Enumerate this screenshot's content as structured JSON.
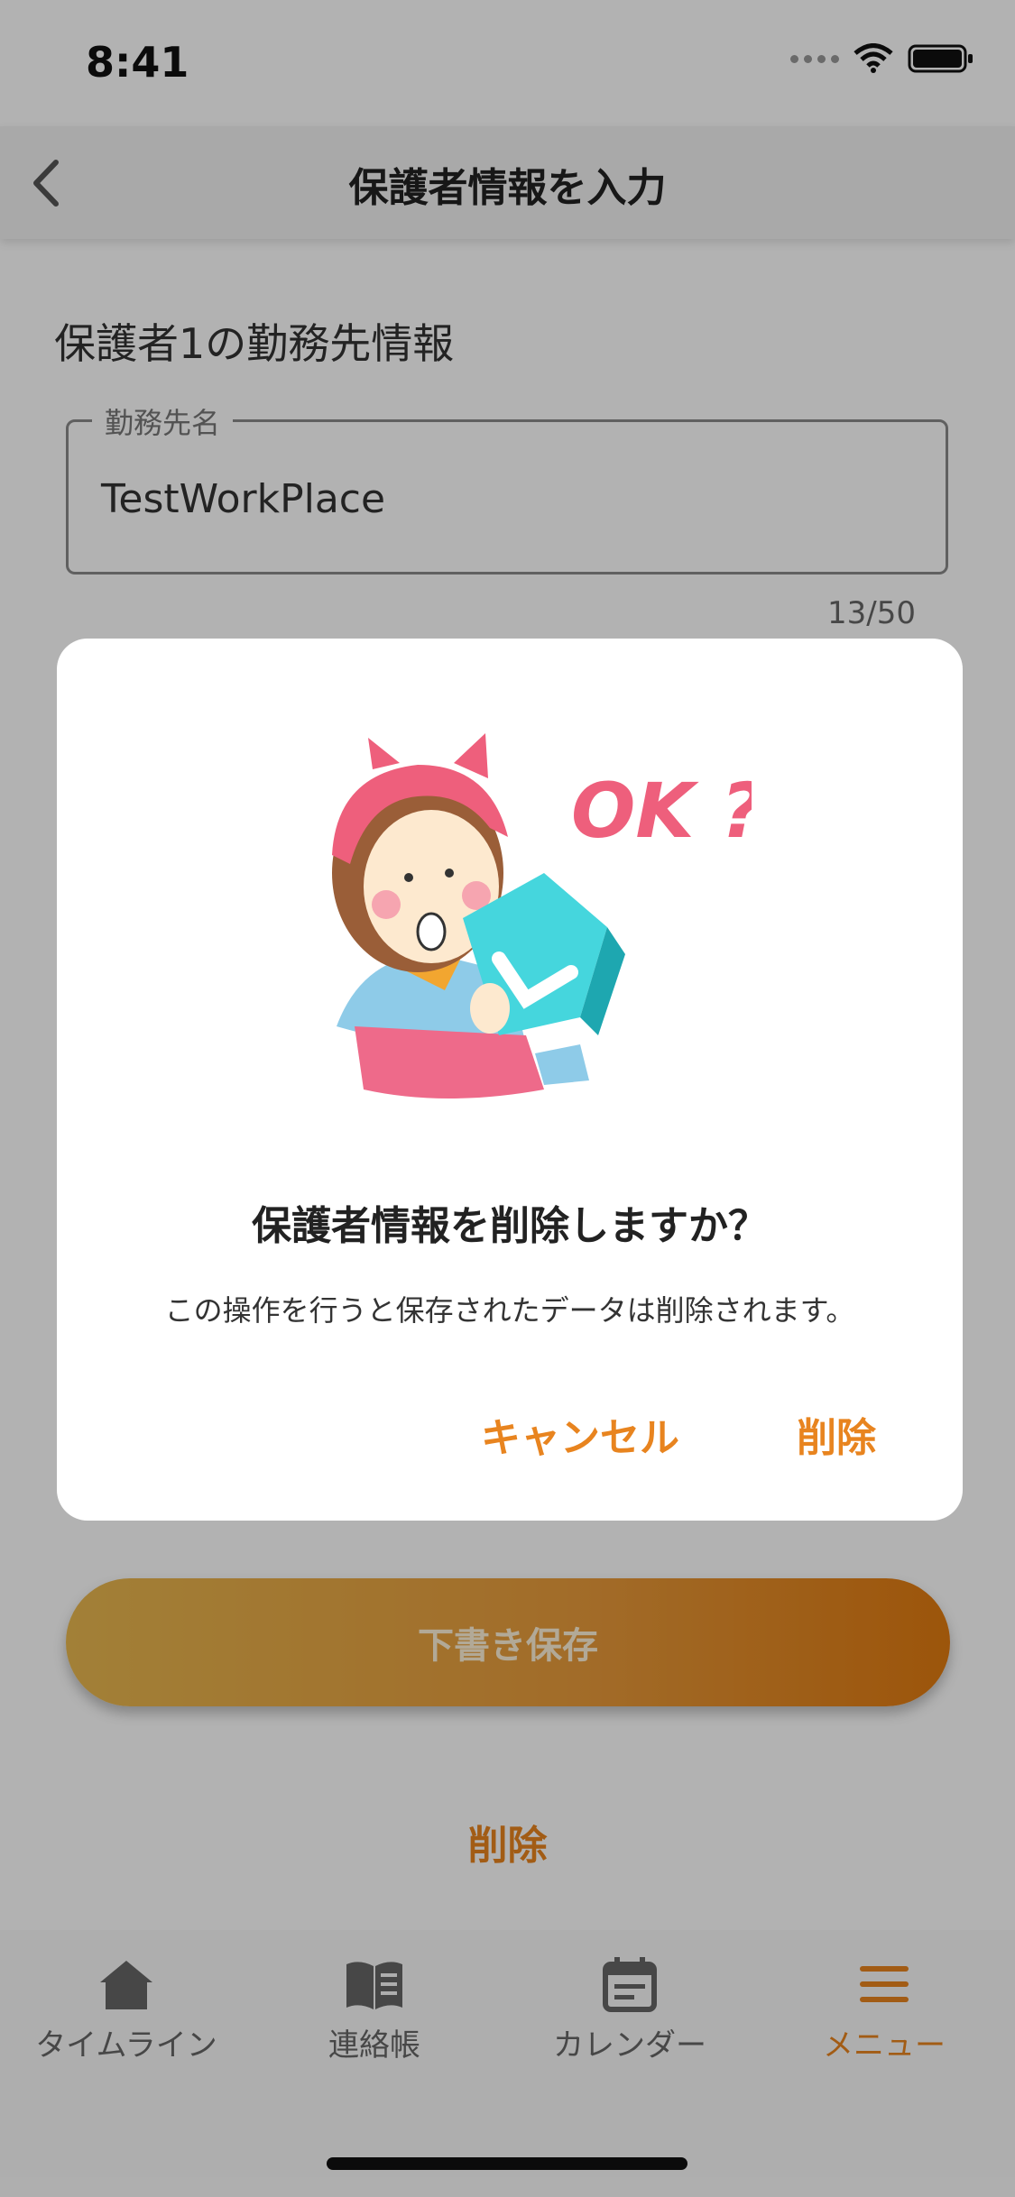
{
  "status_bar": {
    "time": "8:41"
  },
  "nav": {
    "title": "保護者情報を入力"
  },
  "form": {
    "section_title": "保護者1の勤務先情報",
    "workplace_label": "勤務先名",
    "workplace_value": "TestWorkPlace",
    "char_count": "13/50"
  },
  "actions": {
    "draft_save": "下書き保存",
    "delete": "削除"
  },
  "dialog": {
    "illustration_text": "OK ?",
    "title": "保護者情報を削除しますか？",
    "message": "この操作を行うと保存されたデータは削除されます。",
    "cancel_label": "キャンセル",
    "delete_label": "削除"
  },
  "tabs": [
    {
      "label": "タイムライン",
      "icon": "home-icon"
    },
    {
      "label": "連絡帳",
      "icon": "book-icon"
    },
    {
      "label": "カレンダー",
      "icon": "calendar-icon"
    },
    {
      "label": "メニュー",
      "icon": "menu-icon",
      "active": true
    }
  ],
  "colors": {
    "accent": "#e8841f",
    "dialog_bg": "#ffffff",
    "overlay": "#000000"
  }
}
